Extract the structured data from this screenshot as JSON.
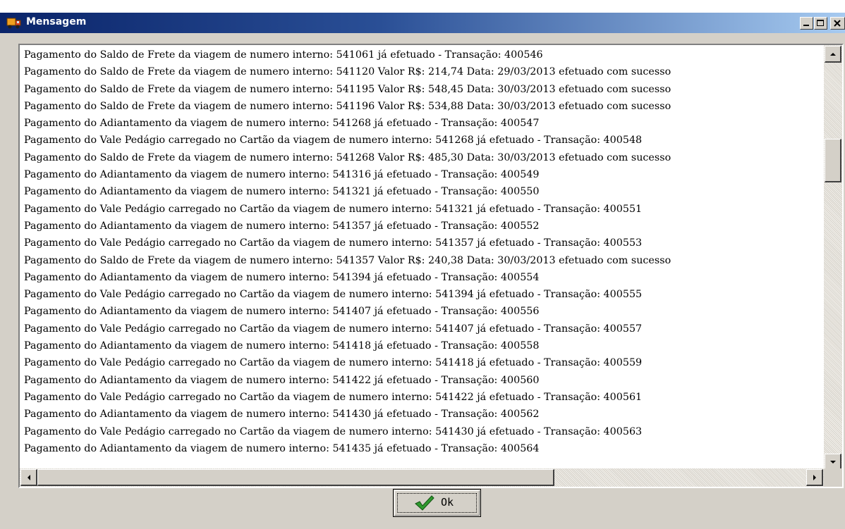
{
  "window": {
    "title": "Mensagem",
    "icon": "truck-icon",
    "controls": [
      "minimize-icon",
      "maximize-icon",
      "close-icon"
    ]
  },
  "messages": [
    "Pagamento do Saldo de Frete da viagem de numero interno: 541061 já efetuado - Transação: 400546",
    "Pagamento do Saldo de Frete da viagem de numero interno: 541120 Valor R$: 214,74 Data: 29/03/2013 efetuado com sucesso",
    "Pagamento do Saldo de Frete da viagem de numero interno: 541195 Valor R$: 548,45 Data: 30/03/2013 efetuado com sucesso",
    "Pagamento do Saldo de Frete da viagem de numero interno: 541196 Valor R$: 534,88 Data: 30/03/2013 efetuado com sucesso",
    "Pagamento do Adiantamento da viagem de numero interno: 541268 já efetuado - Transação: 400547",
    "Pagamento do Vale Pedágio carregado no Cartão da viagem de numero interno: 541268 já efetuado - Transação: 400548",
    "Pagamento do Saldo de Frete da viagem de numero interno: 541268 Valor R$: 485,30 Data: 30/03/2013 efetuado com sucesso",
    "Pagamento do Adiantamento da viagem de numero interno: 541316 já efetuado - Transação: 400549",
    "Pagamento do Adiantamento da viagem de numero interno: 541321 já efetuado - Transação: 400550",
    "Pagamento do Vale Pedágio carregado no Cartão da viagem de numero interno: 541321 já efetuado - Transação: 400551",
    "Pagamento do Adiantamento da viagem de numero interno: 541357 já efetuado - Transação: 400552",
    "Pagamento do Vale Pedágio carregado no Cartão da viagem de numero interno: 541357 já efetuado - Transação: 400553",
    "Pagamento do Saldo de Frete da viagem de numero interno: 541357 Valor R$: 240,38 Data: 30/03/2013 efetuado com sucesso",
    "Pagamento do Adiantamento da viagem de numero interno: 541394 já efetuado - Transação: 400554",
    "Pagamento do Vale Pedágio carregado no Cartão da viagem de numero interno: 541394 já efetuado - Transação: 400555",
    "Pagamento do Adiantamento da viagem de numero interno: 541407 já efetuado - Transação: 400556",
    "Pagamento do Vale Pedágio carregado no Cartão da viagem de numero interno: 541407 já efetuado - Transação: 400557",
    "Pagamento do Adiantamento da viagem de numero interno: 541418 já efetuado - Transação: 400558",
    "Pagamento do Vale Pedágio carregado no Cartão da viagem de numero interno: 541418 já efetuado - Transação: 400559",
    "Pagamento do Adiantamento da viagem de numero interno: 541422 já efetuado - Transação: 400560",
    "Pagamento do Vale Pedágio carregado no Cartão da viagem de numero interno: 541422 já efetuado - Transação: 400561",
    "Pagamento do Adiantamento da viagem de numero interno: 541430 já efetuado - Transação: 400562",
    "Pagamento do Vale Pedágio carregado no Cartão da viagem de numero interno: 541430 já efetuado - Transação: 400563",
    "Pagamento do Adiantamento da viagem de numero interno: 541435 já efetuado - Transação: 400564"
  ],
  "ok_button": {
    "label": "Ok",
    "icon": "checkmark-icon"
  },
  "colors": {
    "title_bar_start": "#0a246a",
    "title_bar_end": "#a6caf0",
    "window_face": "#d4d0c8",
    "checkmark_green": "#2e9a2e"
  }
}
